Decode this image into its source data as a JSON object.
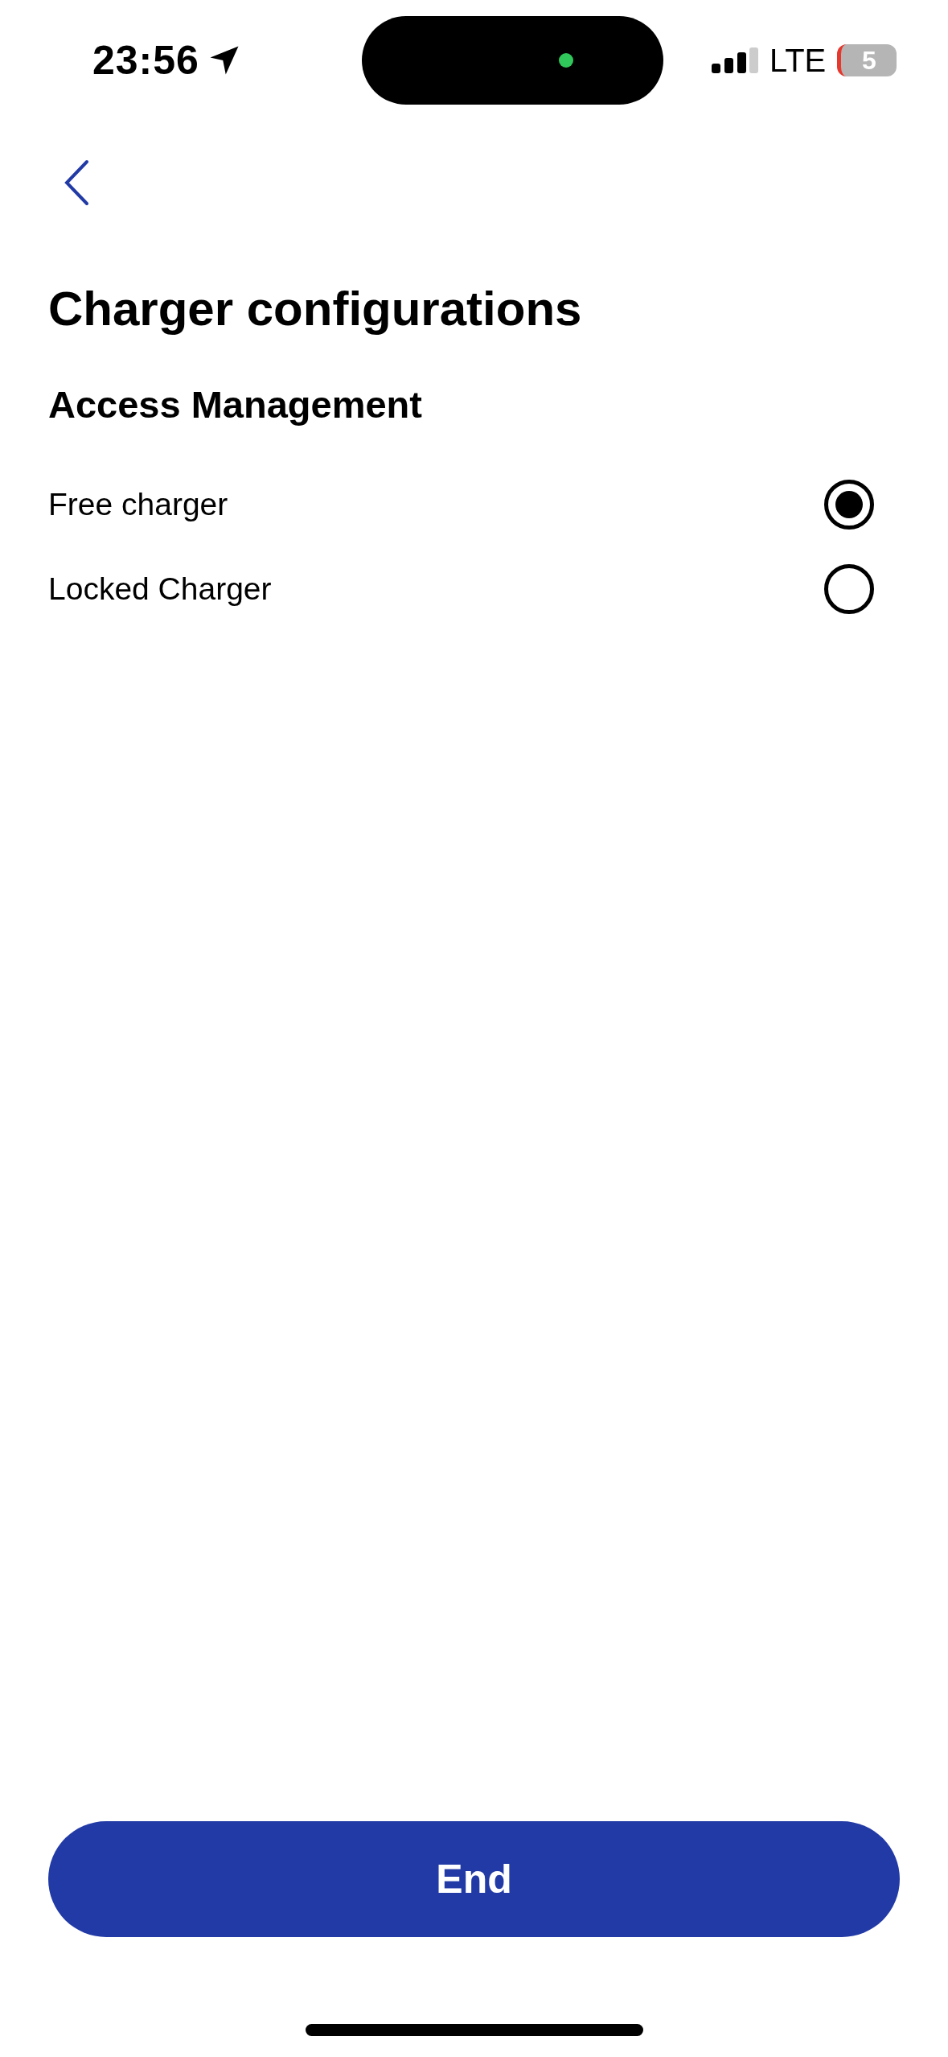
{
  "status_bar": {
    "time": "23:56",
    "network": "LTE",
    "battery": "5"
  },
  "title": "Charger configurations",
  "section": {
    "title": "Access Management",
    "options": [
      {
        "label": "Free charger",
        "selected": true
      },
      {
        "label": "Locked Charger",
        "selected": false
      }
    ]
  },
  "primary_button": "End"
}
